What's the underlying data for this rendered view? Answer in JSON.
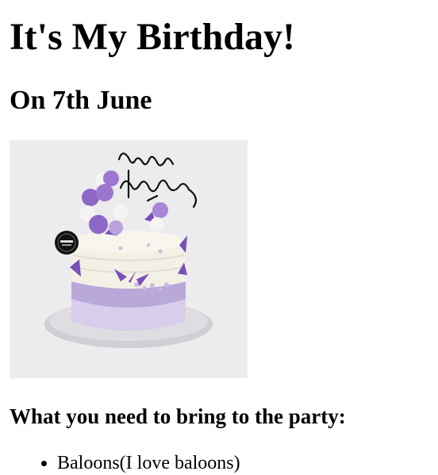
{
  "page": {
    "title": "It's My Birthday!",
    "subtitle": "On 7th June",
    "image": {
      "subject": "birthday-cake-photo",
      "topper_text": "happy birthday",
      "colors": {
        "frosting": "#f3f1e6",
        "lavender": "#b9a9d8",
        "purple": "#7a4fb8",
        "plate": "#cfcfd4",
        "background": "#ececef"
      }
    },
    "bring_heading": "What you need to bring to the party:",
    "items": [
      {
        "label": "Baloons(I love baloons)"
      }
    ]
  }
}
